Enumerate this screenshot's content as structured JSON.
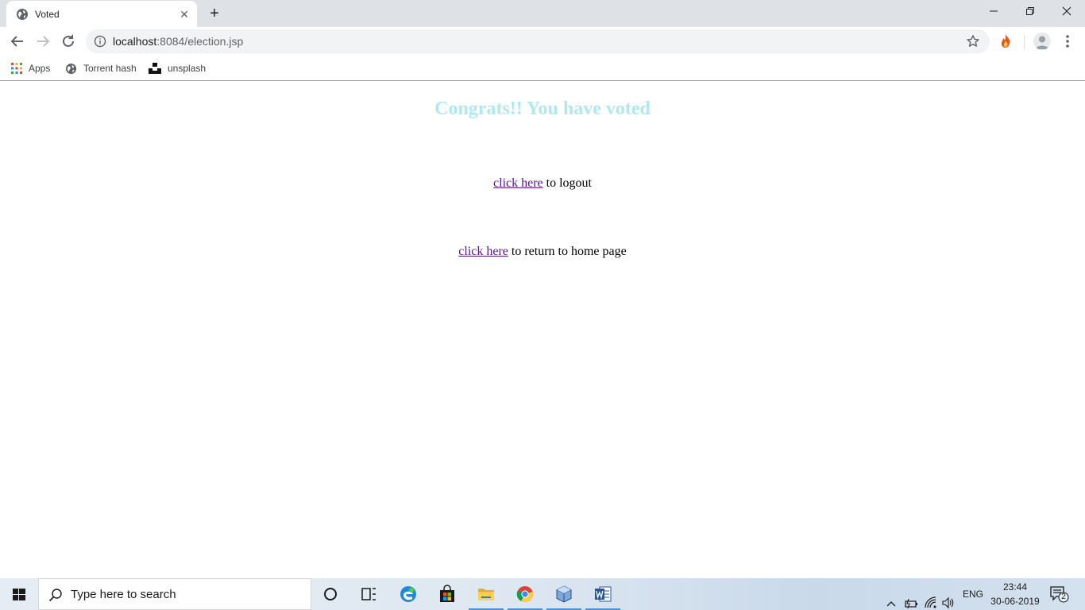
{
  "browser": {
    "tab_title": "Voted",
    "url_host": "localhost",
    "url_rest": ":8084/election.jsp",
    "bookmarks": [
      "Apps",
      "Torrent hash",
      "unsplash"
    ]
  },
  "page": {
    "heading": "Congrats!! You have voted",
    "logout_link": "click here",
    "logout_text": " to logout",
    "home_link": "click here",
    "home_text": " to return to home page",
    "colors": {
      "heading": "#aee9ef",
      "link": "#551a8b"
    }
  },
  "taskbar": {
    "search_placeholder": "Type here to search",
    "language": "ENG",
    "time": "23:44",
    "date": "30-06-2019",
    "notification_count": "2",
    "apps": [
      "cortana-icon",
      "task-view-icon",
      "edge-icon",
      "store-icon",
      "file-explorer-icon",
      "chrome-icon",
      "virtualbox-icon",
      "word-icon"
    ]
  }
}
